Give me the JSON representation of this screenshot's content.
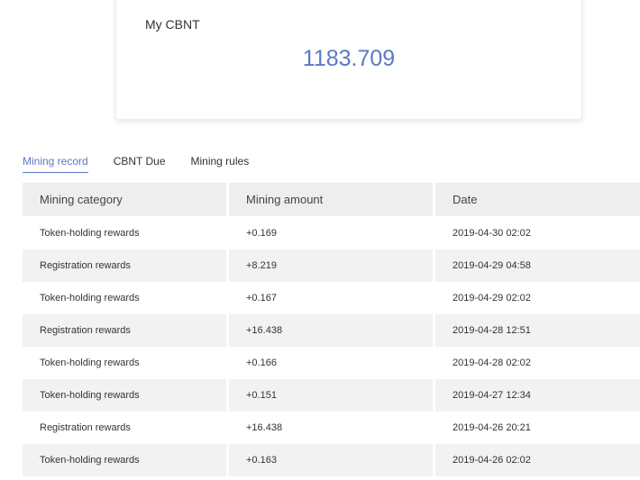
{
  "balance": {
    "label": "My CBNT",
    "value": "1183.709"
  },
  "tabs": [
    {
      "label": "Mining record",
      "active": true
    },
    {
      "label": "CBNT Due",
      "active": false
    },
    {
      "label": "Mining rules",
      "active": false
    }
  ],
  "table": {
    "headers": [
      "Mining category",
      "Mining amount",
      "Date"
    ],
    "rows": [
      {
        "category": "Token-holding rewards",
        "amount": "+0.169",
        "date": "2019-04-30 02:02"
      },
      {
        "category": "Registration rewards",
        "amount": "+8.219",
        "date": "2019-04-29 04:58"
      },
      {
        "category": "Token-holding rewards",
        "amount": "+0.167",
        "date": "2019-04-29 02:02"
      },
      {
        "category": "Registration rewards",
        "amount": "+16.438",
        "date": "2019-04-28 12:51"
      },
      {
        "category": "Token-holding rewards",
        "amount": "+0.166",
        "date": "2019-04-28 02:02"
      },
      {
        "category": "Token-holding rewards",
        "amount": "+0.151",
        "date": "2019-04-27 12:34"
      },
      {
        "category": "Registration rewards",
        "amount": "+16.438",
        "date": "2019-04-26 20:21"
      },
      {
        "category": "Token-holding rewards",
        "amount": "+0.163",
        "date": "2019-04-26 02:02"
      }
    ]
  },
  "colors": {
    "accent": "#5b78c7",
    "header_bg": "#eeeeee",
    "stripe_bg": "#f2f2f2"
  }
}
